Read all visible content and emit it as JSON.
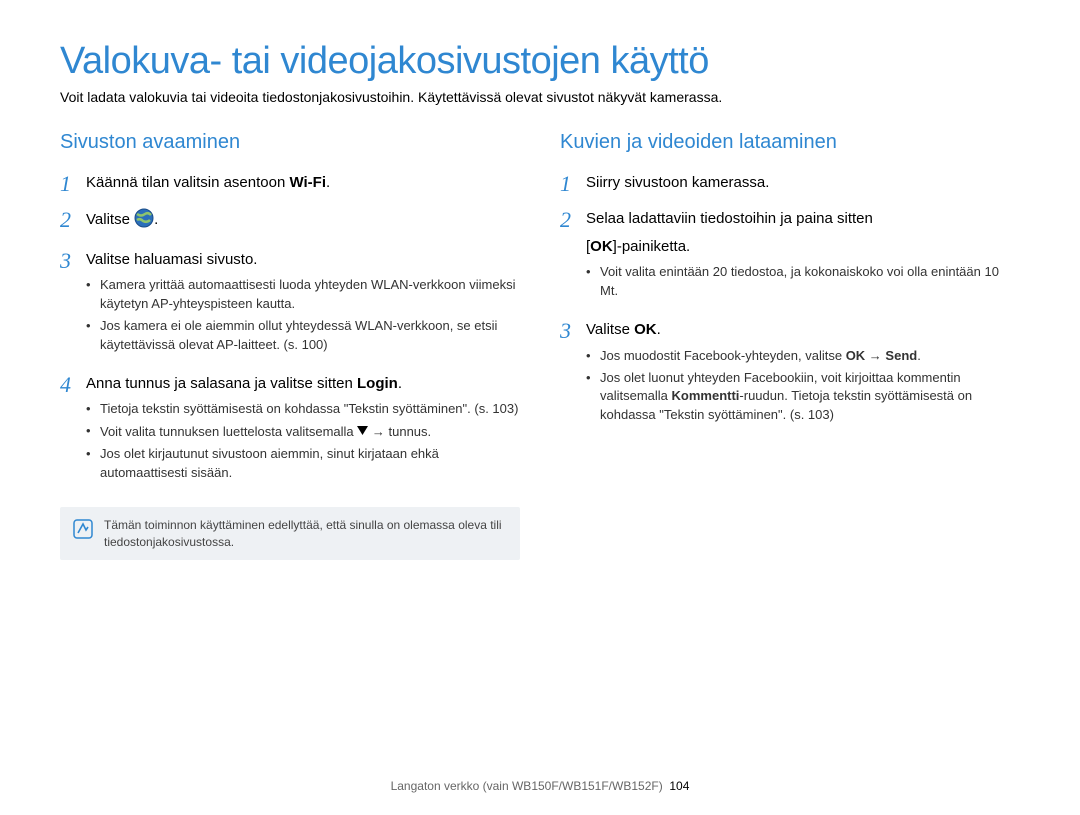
{
  "title": "Valokuva- tai videojakosivustojen käyttö",
  "intro": "Voit ladata valokuvia tai videoita tiedostonjakosivustoihin. Käytettävissä olevat sivustot näkyvät kamerassa.",
  "left": {
    "heading": "Sivuston avaaminen",
    "step1_num": "1",
    "step1_pre": "Käännä tilan valitsin asentoon ",
    "step1_wifi": "Wi-Fi",
    "step1_post": ".",
    "step2_num": "2",
    "step2_pre": "Valitse ",
    "step2_post": ".",
    "step3_num": "3",
    "step3_text": "Valitse haluamasi sivusto.",
    "step3_b1": "Kamera yrittää automaattisesti luoda yhteyden WLAN-verkkoon viimeksi käytetyn AP-yhteyspisteen kautta.",
    "step3_b2": "Jos kamera ei ole aiemmin ollut yhteydessä WLAN-verkkoon, se etsii käytettävissä olevat AP-laitteet. (s. 100)",
    "step4_num": "4",
    "step4_pre": "Anna tunnus ja salasana ja valitse sitten ",
    "step4_login": "Login",
    "step4_post": ".",
    "step4_b1": "Tietoja tekstin syöttämisestä on kohdassa \"Tekstin syöttäminen\". (s. 103)",
    "step4_b2_pre": "Voit valita tunnuksen luettelosta valitsemalla ",
    "step4_b2_arrow": " → ",
    "step4_b2_post": "tunnus.",
    "step4_b3": "Jos olet kirjautunut sivustoon aiemmin, sinut kirjataan ehkä automaattisesti sisään.",
    "note": "Tämän toiminnon käyttäminen edellyttää, että sinulla on olemassa oleva tili tiedostonjakosivustossa."
  },
  "right": {
    "heading": "Kuvien ja videoiden lataaminen",
    "step1_num": "1",
    "step1_text": "Siirry sivustoon kamerassa.",
    "step2_num": "2",
    "step2_line1": "Selaa ladattaviin tiedostoihin ja paina sitten",
    "step2_line2_pre": "[",
    "step2_ok": "OK",
    "step2_line2_post": "]-painiketta.",
    "step2_b1": "Voit valita enintään 20 tiedostoa, ja kokonaiskoko voi olla enintään 10 Mt.",
    "step3_num": "3",
    "step3_pre": "Valitse ",
    "step3_ok": "OK",
    "step3_post": ".",
    "step3_b1_pre": "Jos muodostit Facebook-yhteyden, valitse ",
    "step3_b1_ok": "OK",
    "step3_b1_arrow": " → ",
    "step3_b1_send": "Send",
    "step3_b1_post": ".",
    "step3_b2_pre": "Jos olet luonut yhteyden Facebookiin, voit kirjoittaa kommentin valitsemalla ",
    "step3_b2_bold": "Kommentti",
    "step3_b2_post": "-ruudun. Tietoja tekstin syöttämisestä on kohdassa \"Tekstin syöttäminen\". (s. 103)"
  },
  "footer_text": "Langaton verkko (vain WB150F/WB151F/WB152F)",
  "footer_page": "104"
}
